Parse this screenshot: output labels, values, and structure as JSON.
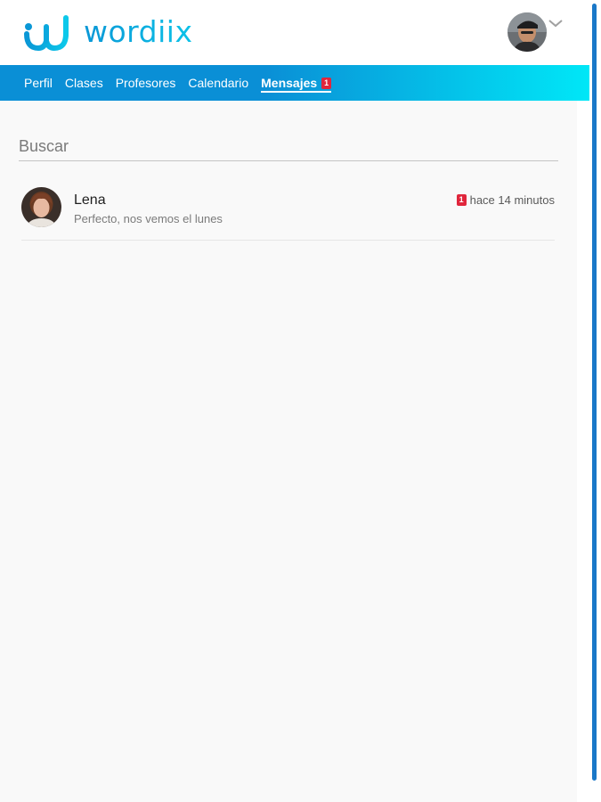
{
  "app": {
    "logo_text": "wordiix",
    "brand_color": "#0cc2e8",
    "brand_dark": "#0a97d6"
  },
  "nav": {
    "items": [
      {
        "label": "Perfil"
      },
      {
        "label": "Clases"
      },
      {
        "label": "Profesores"
      },
      {
        "label": "Calendario"
      },
      {
        "label": "Mensajes",
        "badge": "1",
        "active": true
      }
    ],
    "gradient_start": "#0a8fd6",
    "gradient_end": "#00e7f7"
  },
  "header": {
    "user_avatar_icon": "user-avatar",
    "menu_icon": "chevron-down-icon"
  },
  "search": {
    "placeholder": "Buscar",
    "value": ""
  },
  "conversations": [
    {
      "name": "Lena",
      "preview": "Perfecto, nos vemos el lunes",
      "time": "hace 14 minutos",
      "unread": "1"
    }
  ],
  "colors": {
    "badge": "#e0263c",
    "scrollbar": "#1a78c8",
    "content_bg": "#f9f9f9"
  }
}
